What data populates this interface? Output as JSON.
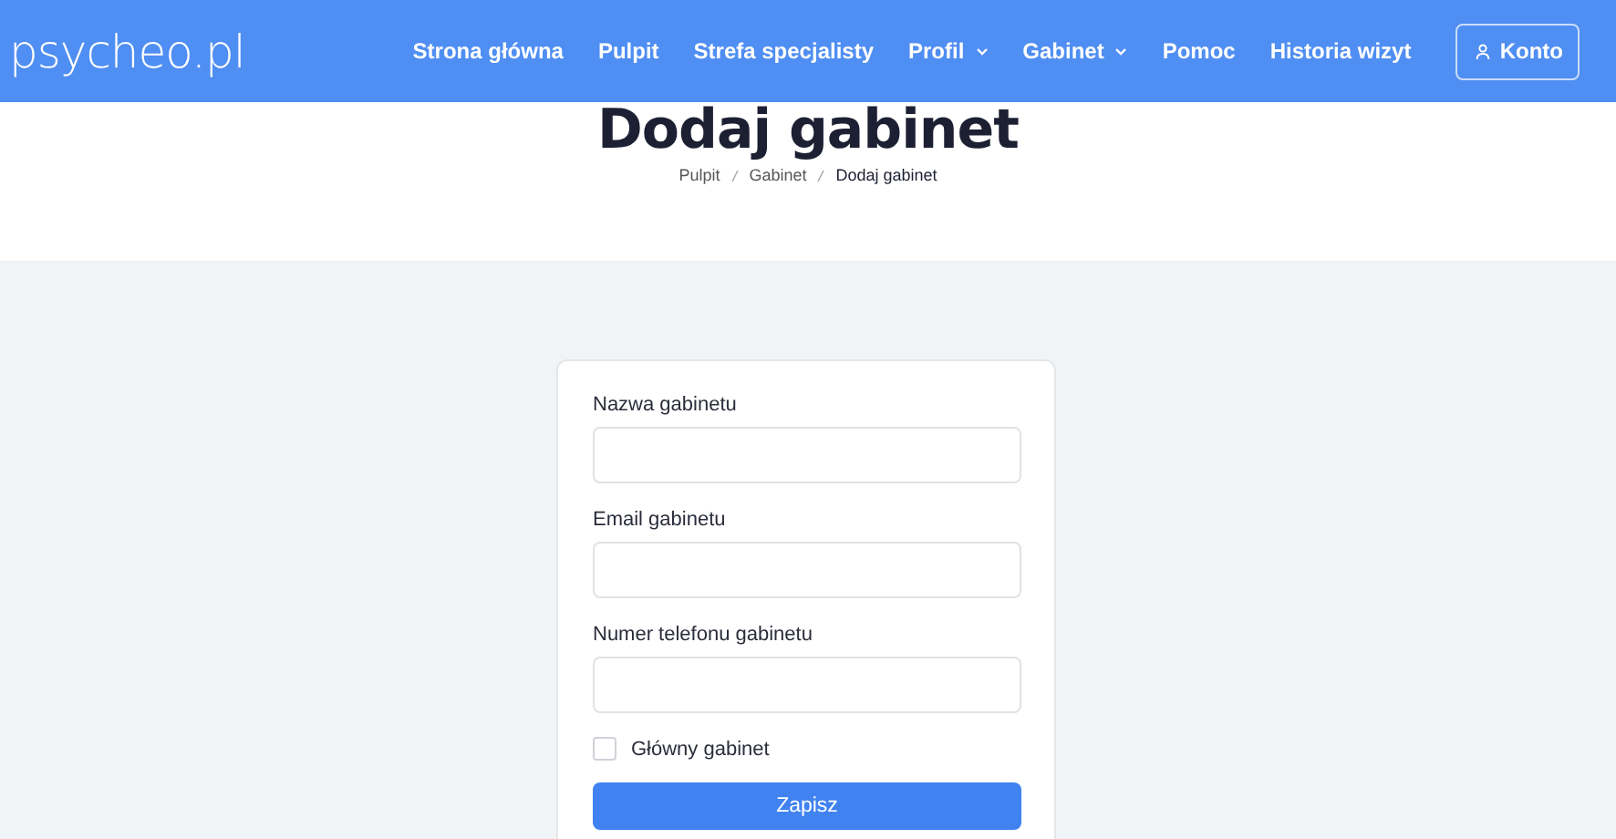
{
  "header": {
    "logo": "psycheo.pl",
    "nav": [
      {
        "label": "Strona główna",
        "dropdown": false
      },
      {
        "label": "Pulpit",
        "dropdown": false
      },
      {
        "label": "Strefa specjalisty",
        "dropdown": false
      },
      {
        "label": "Profil",
        "dropdown": true
      },
      {
        "label": "Gabinet",
        "dropdown": true
      },
      {
        "label": "Pomoc",
        "dropdown": false
      },
      {
        "label": "Historia wizyt",
        "dropdown": false
      }
    ],
    "account_button": "Konto"
  },
  "page_title": "Dodaj gabinet",
  "breadcrumb": [
    {
      "label": "Pulpit",
      "current": false
    },
    {
      "label": "Gabinet",
      "current": false
    },
    {
      "label": "Dodaj gabinet",
      "current": true
    }
  ],
  "form": {
    "fields": [
      {
        "label": "Nazwa gabinetu"
      },
      {
        "label": "Email gabinetu"
      },
      {
        "label": "Numer telefonu gabinetu"
      }
    ],
    "checkbox": {
      "label": "Główny gabinet",
      "checked": false
    },
    "submit": "Zapisz"
  }
}
